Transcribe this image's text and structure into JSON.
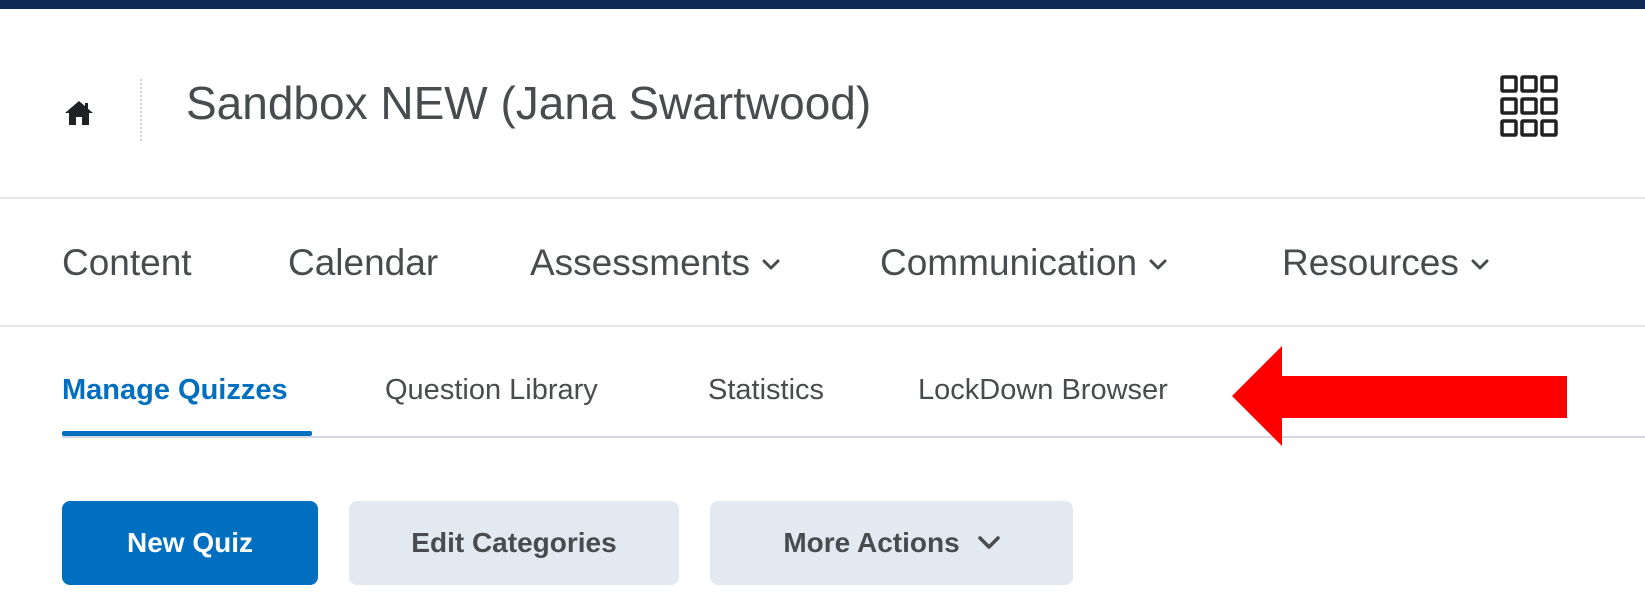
{
  "header": {
    "home_icon": "home-icon",
    "course_title": "Sandbox NEW (Jana Swartwood)",
    "apps_icon": "waffle-grid-icon"
  },
  "navbar": {
    "items": [
      {
        "label": "Content",
        "has_dropdown": false
      },
      {
        "label": "Calendar",
        "has_dropdown": false
      },
      {
        "label": "Assessments",
        "has_dropdown": true
      },
      {
        "label": "Communication",
        "has_dropdown": true
      },
      {
        "label": "Resources",
        "has_dropdown": true
      }
    ]
  },
  "tabs": {
    "items": [
      {
        "label": "Manage Quizzes",
        "active": true
      },
      {
        "label": "Question Library",
        "active": false
      },
      {
        "label": "Statistics",
        "active": false
      },
      {
        "label": "LockDown Browser",
        "active": false
      }
    ]
  },
  "annotation": {
    "arrow_color": "#ff0000",
    "points_to": "LockDown Browser"
  },
  "actions": {
    "new_quiz_label": "New Quiz",
    "edit_categories_label": "Edit Categories",
    "more_actions_label": "More Actions"
  },
  "colors": {
    "brand_blue": "#006fbf",
    "top_bar": "#0d2a55",
    "secondary_button_bg": "#e3e9f1",
    "text": "#494c4e"
  }
}
